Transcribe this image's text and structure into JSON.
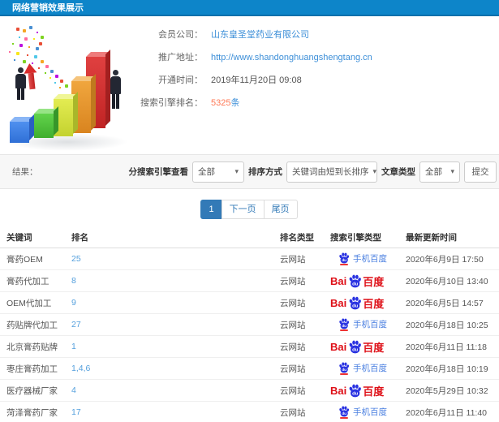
{
  "header": {
    "title": "网络营销效果展示"
  },
  "info": {
    "fields": [
      {
        "label": "会员公司：",
        "value": "山东皇圣堂药业有限公司"
      },
      {
        "label": "推广地址：",
        "value": "http://www.shandonghuangshengtang.cn"
      },
      {
        "label": "开通时间：",
        "value": "2019年11月20日 09:08"
      },
      {
        "label": "搜索引擎排名：",
        "value": "5325",
        "suffix": "条"
      }
    ]
  },
  "filters": {
    "result_label": "结果：",
    "engine_label": "分搜索引擎查看",
    "engine_value": "全部",
    "sort_label": "排序方式",
    "sort_value": "关键词由短到长排序",
    "article_label": "文章类型",
    "article_value": "全部",
    "submit_label": "提交",
    "caret": "▾"
  },
  "pagination": {
    "current": "1",
    "next": "下一页",
    "last": "尾页"
  },
  "table": {
    "headers": [
      "关键词",
      "排名",
      "排名类型",
      "搜索引擎类型",
      "最新更新时间"
    ],
    "engine_logos": {
      "mobile_label": "手机百度",
      "baidu_bai": "Bai",
      "baidu_du": "du",
      "baidu_cn": "百度"
    },
    "rows": [
      {
        "keyword": "膏药OEM",
        "rank": "25",
        "rank_type": "云网站",
        "engine": "mobile",
        "updated": "2020年6月9日 17:50"
      },
      {
        "keyword": "膏药代加工",
        "rank": "8",
        "rank_type": "云网站",
        "engine": "baidu",
        "updated": "2020年6月10日 13:40"
      },
      {
        "keyword": "OEM代加工",
        "rank": "9",
        "rank_type": "云网站",
        "engine": "baidu",
        "updated": "2020年6月5日 14:57"
      },
      {
        "keyword": "药贴牌代加工",
        "rank": "27",
        "rank_type": "云网站",
        "engine": "mobile",
        "updated": "2020年6月18日 10:25"
      },
      {
        "keyword": "北京膏药贴牌",
        "rank": "1",
        "rank_type": "云网站",
        "engine": "baidu",
        "updated": "2020年6月11日 11:18"
      },
      {
        "keyword": "枣庄膏药加工",
        "rank": "1,4,6",
        "rank_type": "云网站",
        "engine": "mobile",
        "updated": "2020年6月18日 10:19"
      },
      {
        "keyword": "医疗器械厂家",
        "rank": "4",
        "rank_type": "云网站",
        "engine": "baidu",
        "updated": "2020年5月29日 10:32"
      },
      {
        "keyword": "菏泽膏药厂家",
        "rank": "17",
        "rank_type": "云网站",
        "engine": "mobile",
        "updated": "2020年6月11日 11:40"
      }
    ]
  },
  "colors": {
    "accent_blue": "#0d85c9",
    "link_blue": "#3d8fd8",
    "highlight_orange": "#ff7956",
    "baidu_red": "#de0f17",
    "baidu_blue": "#2932e1",
    "pager_blue": "#337ab7"
  }
}
